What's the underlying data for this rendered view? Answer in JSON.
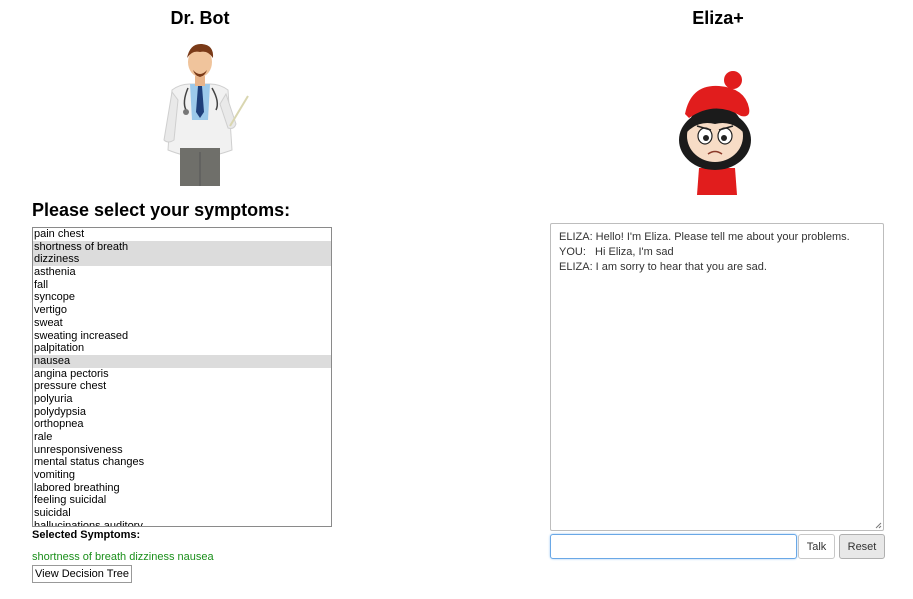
{
  "drbot": {
    "title": "Dr. Bot",
    "heading": "Please select your symptoms:",
    "symptoms": [
      {
        "label": "pain chest",
        "selected": false
      },
      {
        "label": "shortness of breath",
        "selected": true
      },
      {
        "label": "dizziness",
        "selected": true
      },
      {
        "label": "asthenia",
        "selected": false
      },
      {
        "label": "fall",
        "selected": false
      },
      {
        "label": "syncope",
        "selected": false
      },
      {
        "label": "vertigo",
        "selected": false
      },
      {
        "label": "sweat",
        "selected": false
      },
      {
        "label": "sweating increased",
        "selected": false
      },
      {
        "label": "palpitation",
        "selected": false
      },
      {
        "label": "nausea",
        "selected": true
      },
      {
        "label": "angina pectoris",
        "selected": false
      },
      {
        "label": "pressure chest",
        "selected": false
      },
      {
        "label": "polyuria",
        "selected": false
      },
      {
        "label": "polydypsia",
        "selected": false
      },
      {
        "label": "orthopnea",
        "selected": false
      },
      {
        "label": "rale",
        "selected": false
      },
      {
        "label": "unresponsiveness",
        "selected": false
      },
      {
        "label": "mental status changes",
        "selected": false
      },
      {
        "label": "vomiting",
        "selected": false
      },
      {
        "label": "labored breathing",
        "selected": false
      },
      {
        "label": "feeling suicidal",
        "selected": false
      },
      {
        "label": "suicidal",
        "selected": false
      },
      {
        "label": "hallucinations auditory",
        "selected": false
      }
    ],
    "selected_label": "Selected Symptoms:",
    "selected_text": "shortness of breath dizziness nausea",
    "selected_color": "#1a8f1a",
    "tree_button": "View Decision Tree"
  },
  "eliza": {
    "title": "Eliza+",
    "messages": [
      "ELIZA: Hello! I'm Eliza. Please tell me about your problems.",
      "YOU:   Hi Eliza, I'm sad",
      "ELIZA: I am sorry to hear that you are sad."
    ],
    "input_value": "",
    "talk_button": "Talk",
    "reset_button": "Reset"
  }
}
